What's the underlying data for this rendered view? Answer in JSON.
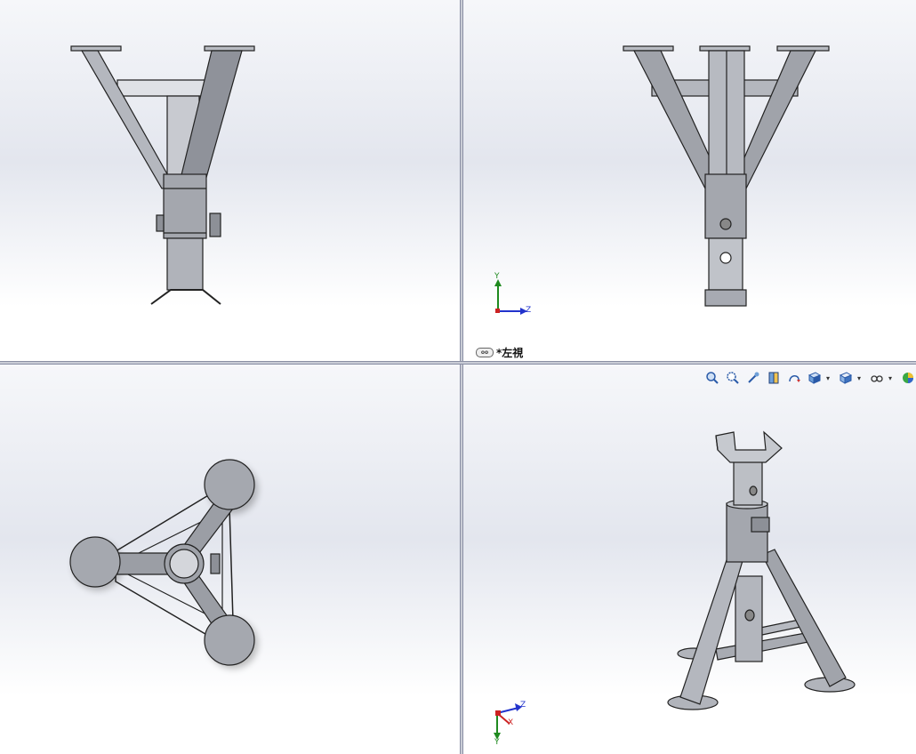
{
  "viewports": {
    "front": {
      "name": "front"
    },
    "left": {
      "label": "*左視",
      "triad": {
        "y": "Y",
        "z": "Z"
      }
    },
    "top": {
      "name": "top"
    },
    "iso": {
      "triad": {
        "x": "X",
        "y": "Y",
        "z": "Z"
      }
    }
  },
  "toolbar": {
    "items": [
      {
        "icon": "zoom-to-fit-icon"
      },
      {
        "icon": "zoom-to-area-icon"
      },
      {
        "icon": "previous-view-icon"
      },
      {
        "icon": "section-view-icon"
      },
      {
        "icon": "dynamic-annotation-icon"
      },
      {
        "icon": "view-orientation-icon"
      },
      {
        "icon": "display-style-icon"
      },
      {
        "icon": "hide-show-items-icon"
      },
      {
        "icon": "edit-appearance-icon"
      }
    ]
  },
  "colors": {
    "part": "#a6a9b1",
    "part_dark": "#6e717a",
    "edge": "#222222",
    "triad_x": "#cc2222",
    "triad_y": "#1f8a1f",
    "triad_z": "#2233cc"
  }
}
